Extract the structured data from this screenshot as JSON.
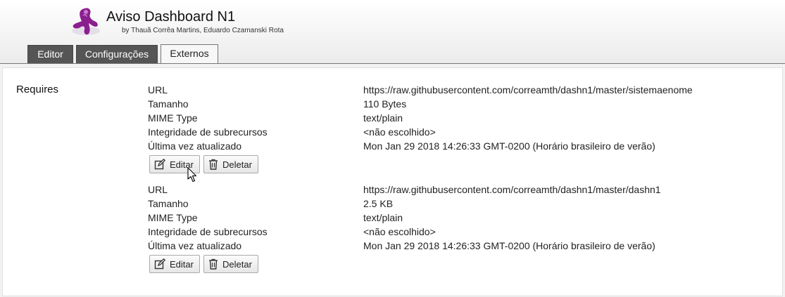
{
  "app": {
    "title": "Aviso Dashboard N1",
    "subtitle": "by Thauã Corrêa Martins, Eduardo Czamanski Rota"
  },
  "tabs": [
    {
      "label": "Editor",
      "active": false
    },
    {
      "label": "Configurações",
      "active": false
    },
    {
      "label": "Externos",
      "active": true
    }
  ],
  "section": {
    "label": "Requires"
  },
  "field_labels": {
    "url": "URL",
    "size": "Tamanho",
    "mime": "MIME Type",
    "integrity": "Integridade de subrecursos",
    "updated": "Última vez atualizado"
  },
  "resources": [
    {
      "url": "https://raw.githubusercontent.com/correamth/dashn1/master/sistemaenome",
      "size": "110 Bytes",
      "mime": "text/plain",
      "integrity": "<não escolhido>",
      "updated": "Mon Jan 29 2018 14:26:33 GMT-0200 (Horário brasileiro de verão)"
    },
    {
      "url": "https://raw.githubusercontent.com/correamth/dashn1/master/dashn1",
      "size": "2.5 KB",
      "mime": "text/plain",
      "integrity": "<não escolhido>",
      "updated": "Mon Jan 29 2018 14:26:33 GMT-0200 (Horário brasileiro de verão)"
    }
  ],
  "buttons": {
    "edit_label": "Editar",
    "delete_label": "Deletar"
  },
  "icons": {
    "logo": "tampermonkey-logo-icon",
    "edit": "edit-icon",
    "delete": "trash-icon",
    "cursor": "mouse-pointer-icon"
  },
  "colors": {
    "tab_dark": "#555555",
    "logo_purple": "#8a1f8f"
  }
}
